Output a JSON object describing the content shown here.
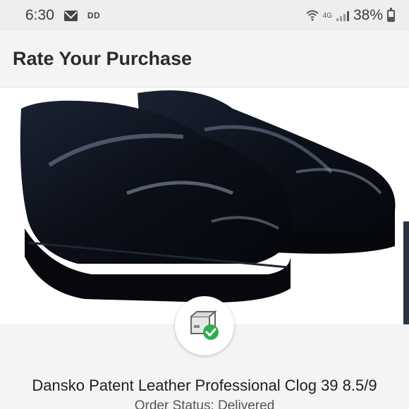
{
  "status_bar": {
    "time": "6:30",
    "notification_label": "DD",
    "network_label": "4G",
    "battery_percent": "38%"
  },
  "header": {
    "title": "Rate Your Purchase"
  },
  "product": {
    "name": "Dansko Patent Leather Professional Clog 39 8.5/9",
    "order_status": "Order Status: Delivered",
    "image_icon": "black-patent-clogs-photo"
  },
  "delivery_badge": {
    "icon": "package-delivered-icon",
    "check_color": "#2fae4e"
  },
  "colors": {
    "status_bar_bg": "#eeeeee",
    "app_bar_bg": "#f4f4f4"
  }
}
